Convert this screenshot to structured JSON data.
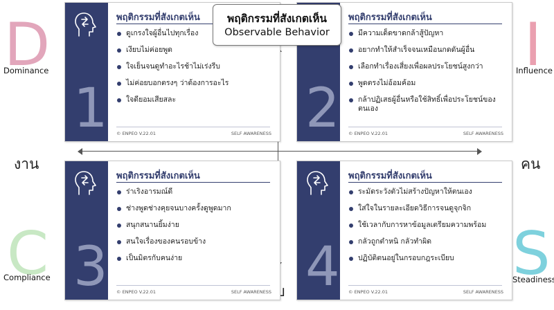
{
  "center": {
    "title_th": "พฤติกรรมที่สังเกตเห็น",
    "title_en": "Observable Behavior"
  },
  "axes": {
    "left": "งาน",
    "right": "คน",
    "bottom": "รับ"
  },
  "styles": [
    {
      "letter": "D",
      "name": "Dominance",
      "color": "#e2a6bb"
    },
    {
      "letter": "I",
      "name": "Influence",
      "color": "#eaa0b0"
    },
    {
      "letter": "C",
      "name": "Compliance",
      "color": "#c8e8c4"
    },
    {
      "letter": "S",
      "name": "Steadiness",
      "color": "#7ed1dd"
    }
  ],
  "cards": [
    {
      "number": "1",
      "title": "พฤติกรรมที่สังเกตเห็น",
      "items": [
        "ดูเกรงใจผู้อื่นไปทุกเรื่อง",
        "เงียบไม่ค่อยพูด",
        "ใจเย็นจนดูทำอะไรช้าไม่เร่งรีบ",
        "ไม่ค่อยบอกตรงๆ ว่าต้องการอะไร",
        "ใจดียอมเสียสละ"
      ],
      "footer_left": "© ENPEO V.22.01",
      "footer_right": "SELF AWARENESS"
    },
    {
      "number": "2",
      "title": "พฤติกรรมที่สังเกตเห็น",
      "items": [
        "มีความเด็ดขาดกล้าสู้ปัญหา",
        "อยากทำให้สำเร็จจนเหมือนกดดันผู้อื่น",
        "เลือกทำเรื่องเสี่ยงเพื่อผลประโยชน์สูงกว่า",
        "พูดตรงไม่อ้อมค้อม",
        "กล้าปฏิเสธผู้อื่นหรือใช้สิทธิ์เพื่อประโยชน์ของตนเอง"
      ],
      "footer_left": "© ENPEO V.22.01",
      "footer_right": "SELF AWARENESS"
    },
    {
      "number": "3",
      "title": "พฤติกรรมที่สังเกตเห็น",
      "items": [
        "ร่าเริงอารมณ์ดี",
        "ช่างพูดช่างคุยจนบางครั้งดูพูดมาก",
        "สนุกสนานยิ้มง่าย",
        "สนใจเรื่องของคนรอบข้าง",
        "เป็นมิตรกับคนง่าย"
      ],
      "footer_left": "© ENPEO V.22.01",
      "footer_right": "SELF AWARENESS"
    },
    {
      "number": "4",
      "title": "พฤติกรรมที่สังเกตเห็น",
      "items": [
        "ระมัดระวังตัวไม่สร้างปัญหาให้ตนเอง",
        "ใส่ใจในรายละเอียดวิธีการจนดูจุกจิก",
        "ใช้เวลากับการหาข้อมูลเตรียมความพร้อม",
        "กลัวถูกตำหนิ กลัวทำผิด",
        "ปฏิบัติตนอยู่ในกรอบกฎระเบียบ"
      ],
      "footer_left": "© ENPEO V.22.01",
      "footer_right": "SELF AWARENESS"
    }
  ]
}
